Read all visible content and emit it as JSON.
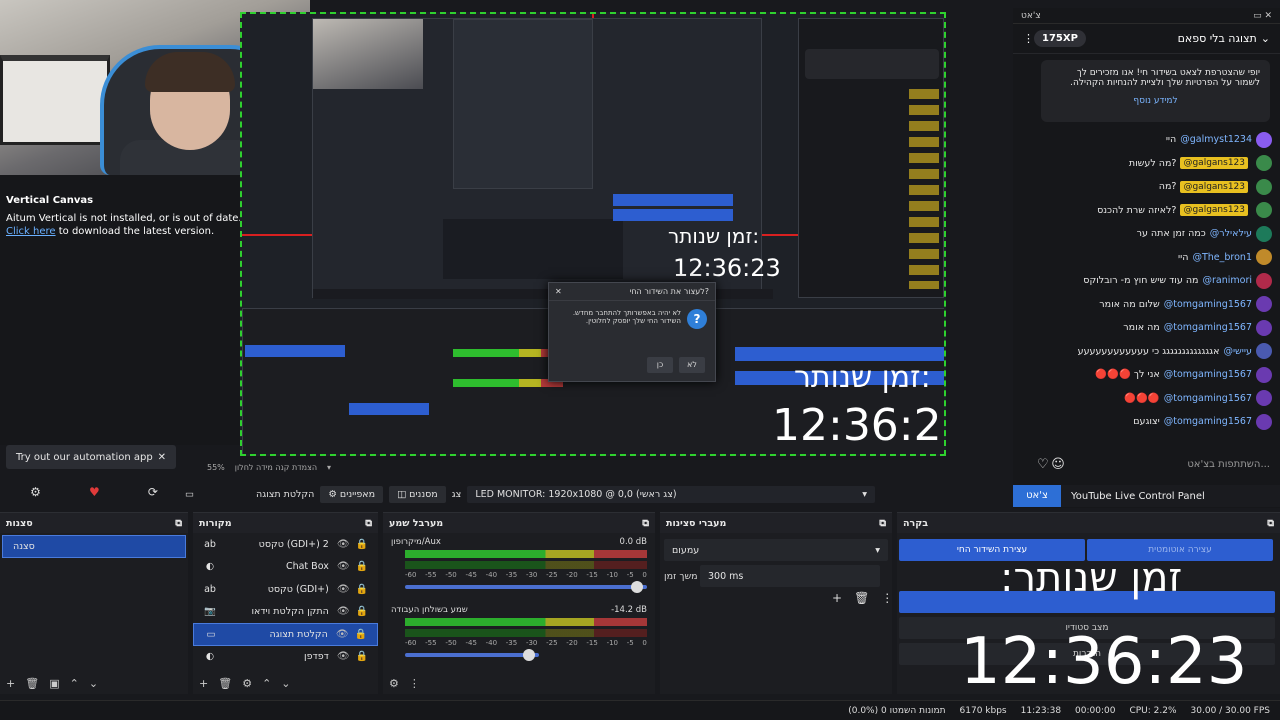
{
  "notice": {
    "title": "Vertical Canvas",
    "line1": "Aitum Vertical is not installed, or is out of date.",
    "link": "Click here",
    "line2": " to download the latest version."
  },
  "automation": {
    "label": "Try out our automation app",
    "close": "✕"
  },
  "preview": {
    "clock_label": "זמן שנותר:",
    "clock_time": "12:36:23",
    "dialog_title": "לעצור את השידור החי?",
    "dialog_text": "לא יהיה באפשרותך להתחבר מחדש. השידור החי שלך יופסק לחלוטין.",
    "dialog_yes": "כן",
    "dialog_no": "לא"
  },
  "preview_toolbar": {
    "zoom": "55%",
    "label": "הצמדת קנה מידה לחלון"
  },
  "scenebar": {
    "transitions": "הקלטת תצוגה",
    "properties": "מאפיינים",
    "filters": "מסננים",
    "screen": "צג",
    "monitor": "LED MONITOR: 1920x1080 @ 0,0 (צג ראשי)"
  },
  "chat": {
    "tab_title": "צ'אט",
    "view": "תצוגה בלי ספאם",
    "xp": "175XP",
    "alert": "יופי שהצטרפת לצאט בשידור חי! אנו מזכירים לך לשמור על הפרטיות שלך ולציית להנחיות הקהילה.",
    "alert_more": "למידע נוסף",
    "messages": [
      {
        "text": "היי",
        "tag": "",
        "user": "@galmyst1234",
        "color": "#8a5cf0"
      },
      {
        "text": "מה לעשות?",
        "tag": "@galgans123",
        "user": "",
        "color": "#3a8a4a"
      },
      {
        "text": "מה?",
        "tag": "@galgans123",
        "user": "",
        "color": "#3a8a4a"
      },
      {
        "text": "לאיזה שרת להכנס?",
        "tag": "@galgans123",
        "user": "",
        "color": "#3a8a4a"
      },
      {
        "text": "כמה זמן אתה ער",
        "tag": "",
        "user": "@עילאילר",
        "color": "#1d7a5a"
      },
      {
        "text": "היי",
        "tag": "",
        "user": "@The_bron1",
        "color": "#c08a2a"
      },
      {
        "text": "מה עוד שיש חוץ מ- רובלוקס",
        "tag": "",
        "user": "@ranimori",
        "color": "#b02a4a"
      },
      {
        "text": "שלום מה אומר",
        "tag": "",
        "user": "@tomgaming1567",
        "color": "#6a3ab0"
      },
      {
        "text": "מה אומר",
        "tag": "",
        "user": "@tomgaming1567",
        "color": "#6a3ab0"
      },
      {
        "text": "אגגגגגגגגגגגגג כי עעעעעעעעעעעע",
        "tag": "",
        "user": "@עיישי",
        "color": "#4a5ab0"
      },
      {
        "text": "🔴🔴🔴 אני לך",
        "tag": "",
        "user": "@tomgaming1567",
        "color": "#6a3ab0"
      },
      {
        "text": "🔴🔴🔴",
        "tag": "",
        "user": "@tomgaming1567",
        "color": "#6a3ab0"
      },
      {
        "text": "יצוגעם",
        "tag": "",
        "user": "@tomgaming1567",
        "color": "#6a3ab0"
      }
    ],
    "input_placeholder": "השתתפות בצ'אט...",
    "tab_chat": "צ'אט",
    "tab_panel": "YouTube Live Control Panel"
  },
  "docks": {
    "scenes": {
      "title": "סצנות",
      "items": [
        "סצנה"
      ]
    },
    "sources": {
      "title": "מקורות",
      "items": [
        {
          "icon": "ab",
          "label": "טקסט (GDI+) 2",
          "sel": false
        },
        {
          "icon": "◐",
          "label": "Chat Box",
          "sel": false
        },
        {
          "icon": "ab",
          "label": "טקסט (GDI+)",
          "sel": false
        },
        {
          "icon": "📷",
          "label": "התקן הקלטת וידאו",
          "sel": false
        },
        {
          "icon": "▭",
          "label": "הקלטת תצוגה",
          "sel": true
        },
        {
          "icon": "◐",
          "label": "דפדפן",
          "sel": false
        }
      ]
    },
    "mixer": {
      "title": "מערבל שמע",
      "ch1": "מיקרופון/Aux",
      "ch1_db": "0.0 dB",
      "ch2": "שמע בשולחן העבודה",
      "ch2_db": "-14.2 dB",
      "scale": [
        "-60",
        "-55",
        "-50",
        "-45",
        "-40",
        "-35",
        "-30",
        "-25",
        "-20",
        "-15",
        "-10",
        "-5",
        "0"
      ]
    },
    "transitions": {
      "title": "מעברי סצינות",
      "type": "עמעום",
      "duration_label": "משך זמן",
      "duration": "300 ms"
    },
    "controls": {
      "title": "בקרה",
      "stop_stream": "עצירת השידור החי",
      "auto": "עצירה אוטומטית",
      "studio": "מצב סטודיו",
      "settings": "הגדרות"
    }
  },
  "status": {
    "dropped": "(0.0%) 0 תמונות השמטו",
    "bitrate": "6170 kbps",
    "live": "11:23:38",
    "rec": "00:00:00",
    "cpu": "CPU: 2.2%",
    "fps": "30.00 / 30.00 FPS"
  }
}
